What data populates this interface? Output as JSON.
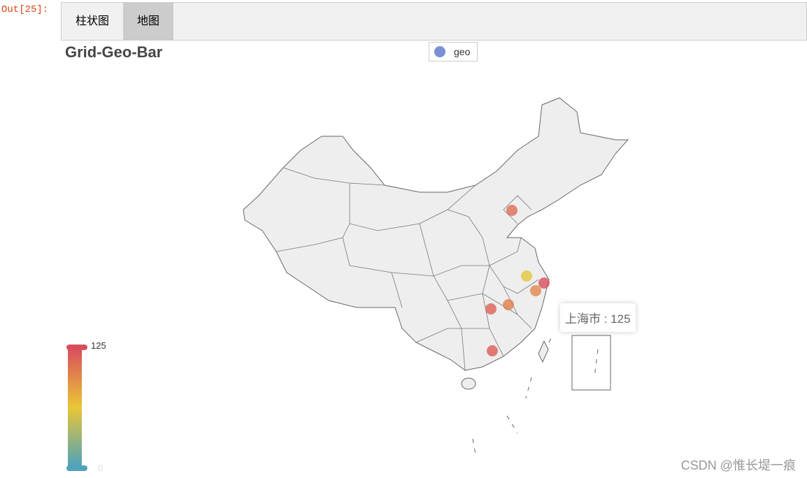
{
  "cell_label": "Out[25]:",
  "tabs": [
    {
      "label": "柱状图",
      "active": false
    },
    {
      "label": "地图",
      "active": true
    }
  ],
  "chart": {
    "title": "Grid-Geo-Bar",
    "legend": {
      "label": "geo",
      "color": "#7b8fd4"
    },
    "visual_map": {
      "max_label": "125",
      "min_label": "0",
      "max": 125,
      "min": 0,
      "colors": [
        "#d94e5d",
        "#eac736",
        "#50a3ba"
      ]
    },
    "tooltip": {
      "name": "上海市",
      "value": "125",
      "text": "上海市 : 125"
    },
    "map": "china",
    "area_color": "#eeeeee",
    "border_color": "#666666"
  },
  "chart_data": {
    "type": "scatter",
    "map": "china",
    "points": [
      {
        "name": "上海市",
        "value": 125
      },
      {
        "value": 110
      },
      {
        "value": 95
      },
      {
        "value": 60
      },
      {
        "value": 115
      },
      {
        "value": 100
      },
      {
        "value": 118
      }
    ]
  },
  "watermark": "CSDN @惟长堤一痕"
}
